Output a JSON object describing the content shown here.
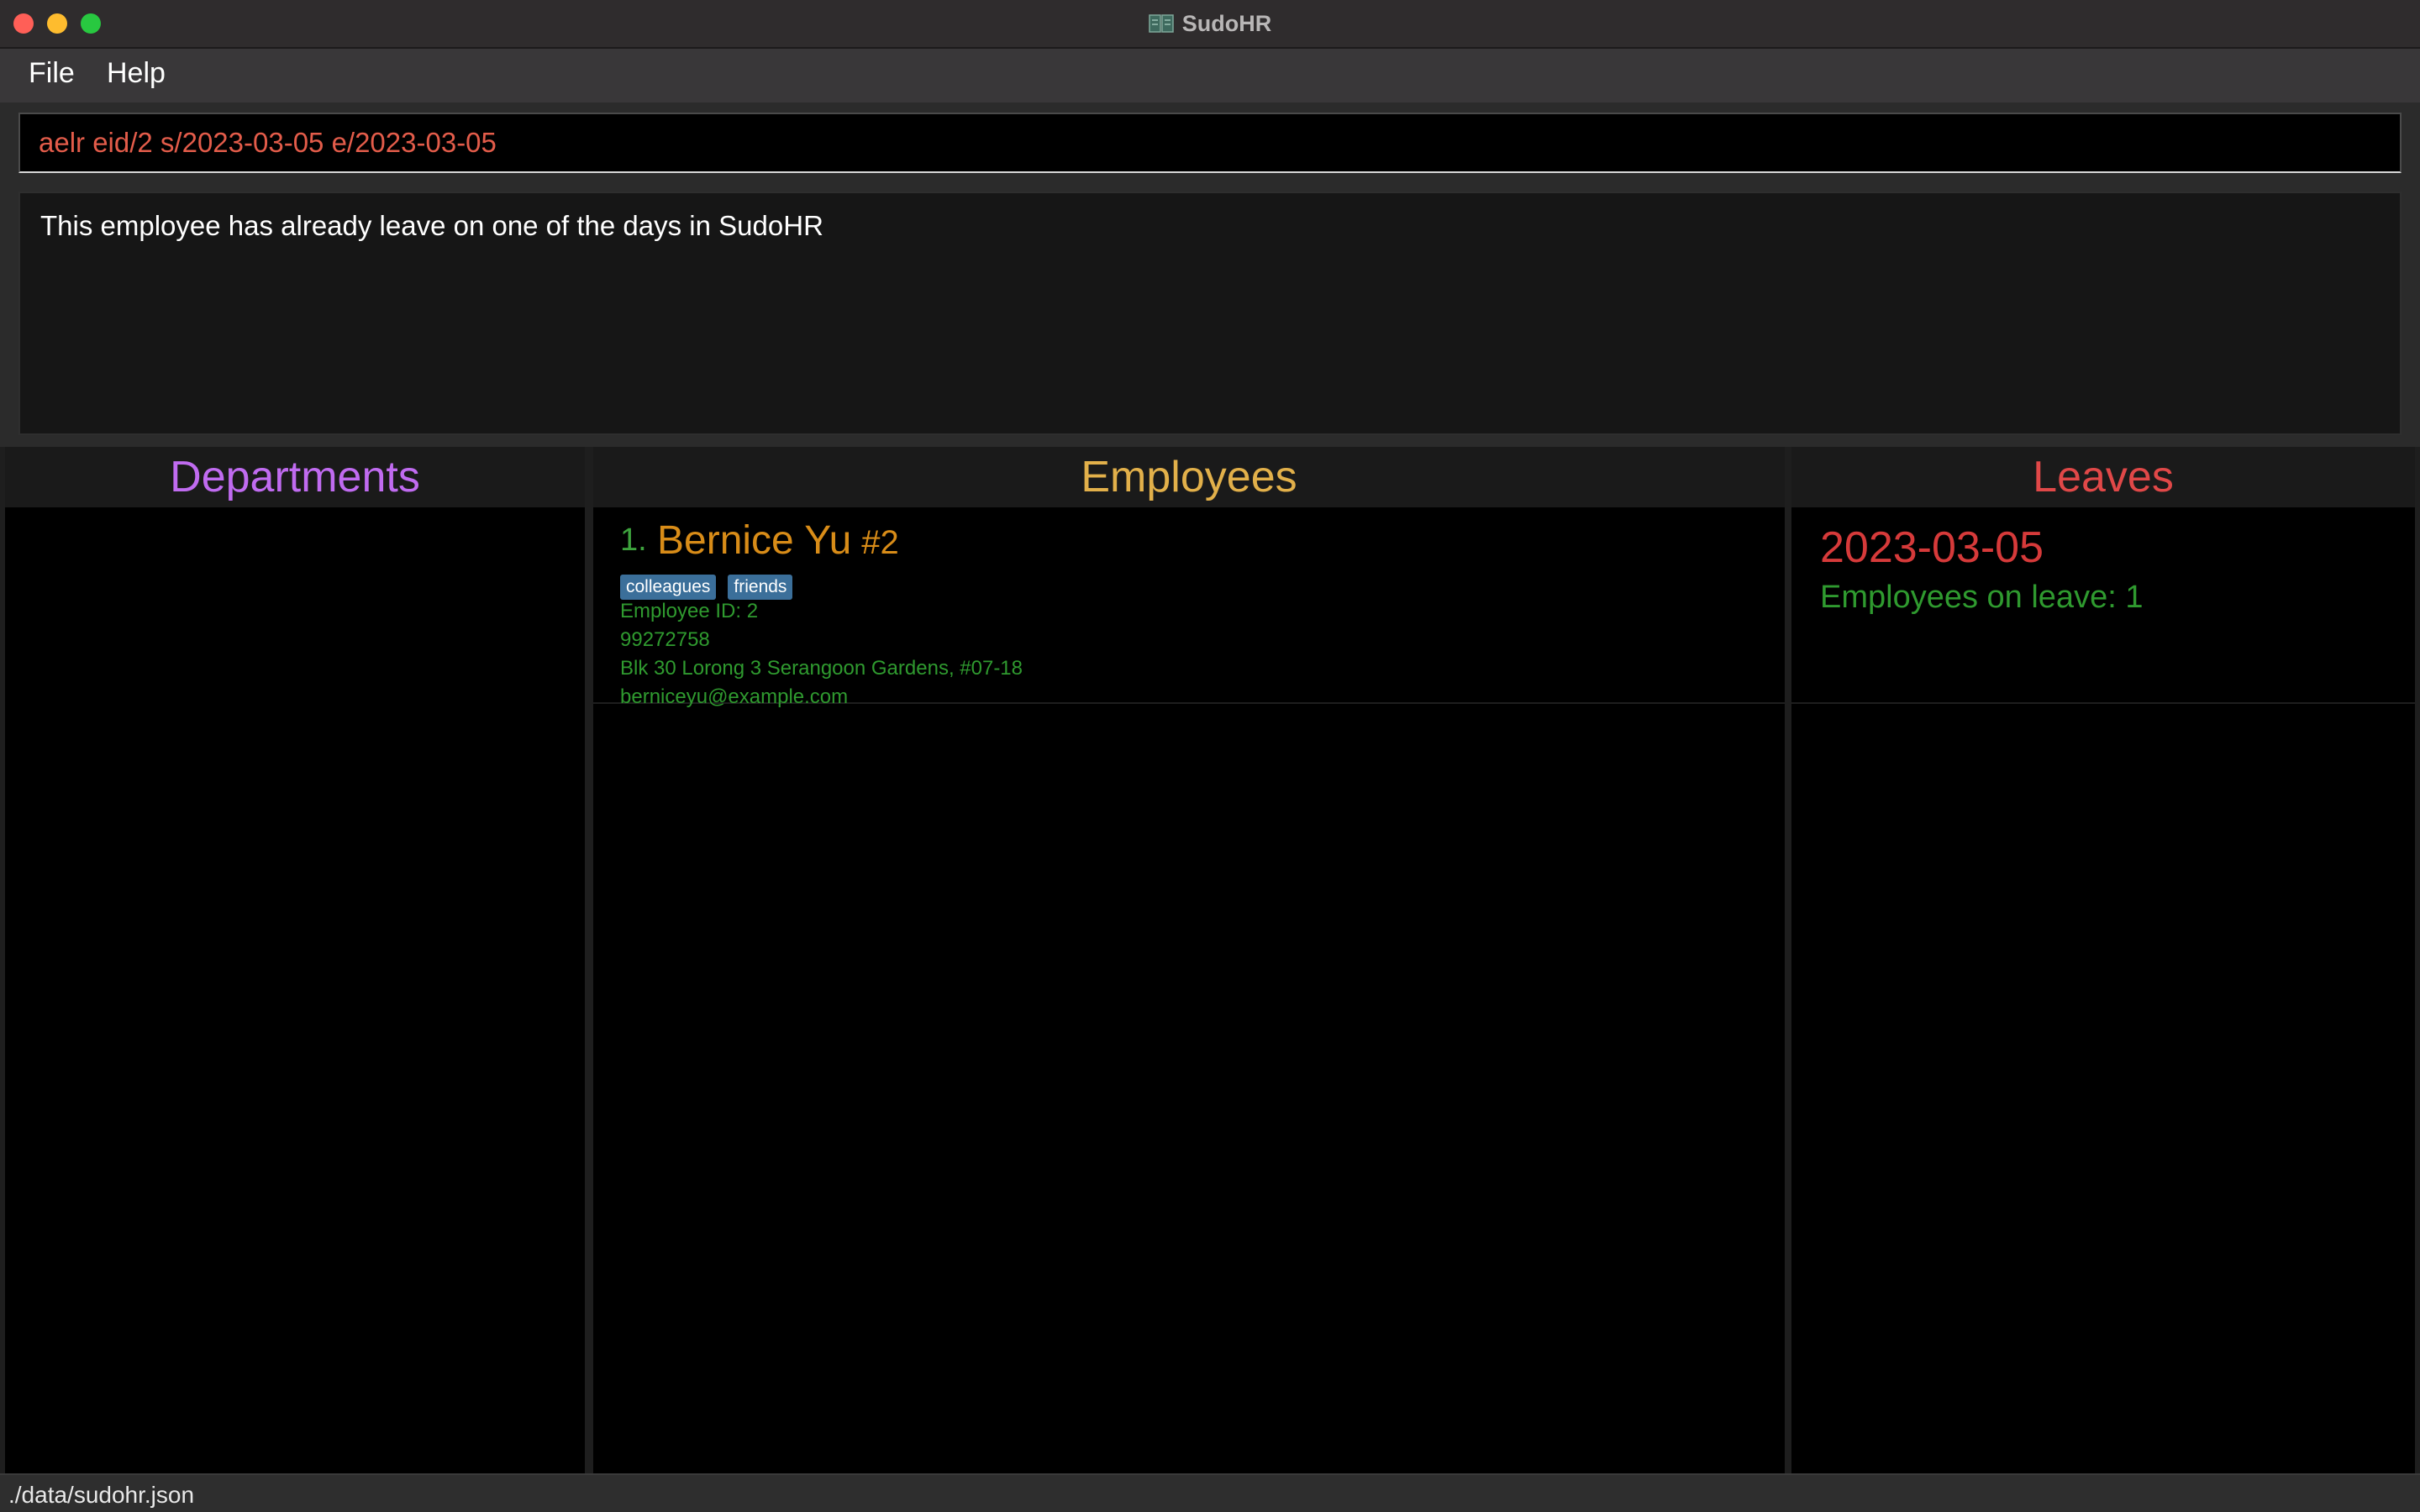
{
  "window": {
    "title": "SudoHR"
  },
  "menu": {
    "file": "File",
    "help": "Help"
  },
  "command": {
    "value": "aelr eid/2 s/2023-03-05 e/2023-03-05",
    "placeholder": ""
  },
  "result": {
    "message": "This employee has already leave on one of the days in SudoHR"
  },
  "panels": {
    "departments": {
      "title": "Departments"
    },
    "employees": {
      "title": "Employees",
      "items": [
        {
          "index": "1.",
          "name": "Bernice Yu",
          "hash_id": "#2",
          "tags": [
            "colleagues",
            "friends"
          ],
          "employee_id": "Employee ID: 2",
          "phone": "99272758",
          "address": "Blk 30 Lorong 3 Serangoon Gardens, #07-18",
          "email": "berniceyu@example.com"
        }
      ]
    },
    "leaves": {
      "title": "Leaves",
      "items": [
        {
          "date": "2023-03-05",
          "count_label": "Employees on leave: 1"
        }
      ]
    }
  },
  "status": {
    "path": "./data/sudohr.json"
  },
  "colors": {
    "departments_title": "#c06bf0",
    "employees_title": "#e2b04a",
    "leaves_title": "#e04848",
    "command_text": "#e35c4a",
    "tag_bg": "#3b6f9a",
    "info_green": "#2f9a2f",
    "name_orange": "#d88c18"
  },
  "icons": {
    "title": "book-icon"
  }
}
